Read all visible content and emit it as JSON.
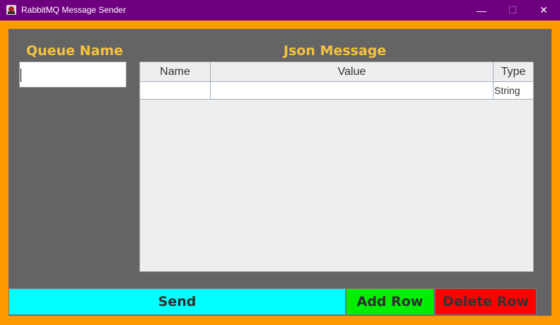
{
  "window": {
    "title": "RabbitMQ Message Sender",
    "minimize_glyph": "—",
    "maximize_glyph": "☐",
    "close_glyph": "✕"
  },
  "colors": {
    "titlebar": "#6E0080",
    "frame": "#FF9900",
    "panel": "#646464",
    "heading": "#F5C242",
    "send": "#00FFFF",
    "add_row": "#00EE00",
    "delete_row": "#FF0000"
  },
  "queue": {
    "heading": "Queue Name",
    "value": ""
  },
  "json_message": {
    "heading": "Json Message",
    "columns": [
      "Name",
      "Value",
      "Type"
    ],
    "rows": [
      {
        "name": "",
        "value": "",
        "type": "String"
      }
    ]
  },
  "buttons": {
    "send": "Send",
    "add_row": "Add Row",
    "delete_row": "Delete Row"
  }
}
